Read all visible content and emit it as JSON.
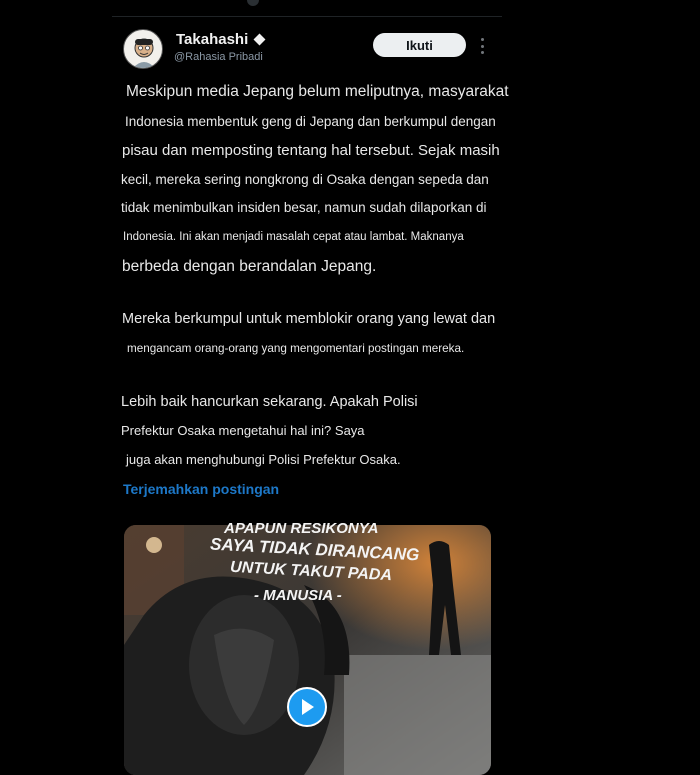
{
  "post": {
    "author": {
      "display_name": "Takahashi",
      "handle": "@Rahasia Pribadi",
      "badge_icon": "verified-diamond-icon"
    },
    "follow_label": "Ikuti",
    "more_icon": "more-vertical-icon",
    "lines": [
      "Meskipun media Jepang belum meliputnya, masyarakat",
      "Indonesia membentuk geng di Jepang dan berkumpul dengan",
      "pisau dan memposting tentang hal tersebut. Sejak masih",
      "kecil, mereka sering nongkrong di Osaka dengan sepeda dan",
      "tidak menimbulkan insiden besar, namun sudah dilaporkan di",
      "Indonesia. Ini akan menjadi masalah cepat atau lambat. Maknanya",
      "berbeda dengan berandalan Jepang.",
      "Mereka berkumpul untuk memblokir orang yang lewat dan",
      "mengancam orang-orang yang mengomentari postingan mereka.",
      "Lebih baik hancurkan sekarang. Apakah Polisi",
      "Prefektur Osaka mengetahui hal ini? Saya",
      "juga akan menghubungi Polisi Prefektur Osaka."
    ],
    "translate_label": "Terjemahkan postingan",
    "video": {
      "caption_lines": [
        "APAPUN RESIKONYA",
        "SAYA TIDAK DIRANCANG",
        "UNTUK TAKUT PADA",
        "- MANUSIA -"
      ],
      "play_icon": "play-icon"
    }
  },
  "colors": {
    "background": "#000000",
    "text": "#e8e8e8",
    "link": "#1d78c8",
    "follow_button_bg": "#eceff1",
    "play_button": "#1d9bf0"
  }
}
